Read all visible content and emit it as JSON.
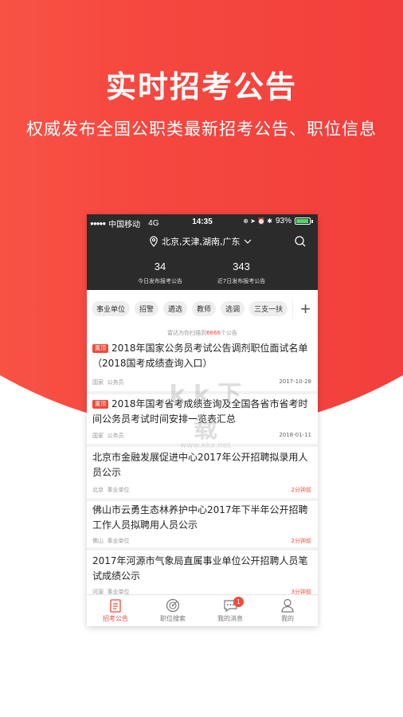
{
  "hero": {
    "title": "实时招考公告",
    "subtitle": "权威发布全国公职类最新招考公告、职位信息"
  },
  "status_bar": {
    "carrier": "中国移动",
    "network": "4G",
    "time": "14:35",
    "battery": "93%"
  },
  "header": {
    "location": "北京,天津,湖南,广东",
    "today_count": "34",
    "today_label": "今日发布报考公告",
    "week_count": "343",
    "week_label": "近7日发布报考公告"
  },
  "tags": [
    "事业单位",
    "招警",
    "遴选",
    "教师",
    "选调",
    "三支一扶"
  ],
  "scan_note": {
    "prefix": "雷达为你扫描到",
    "count": "6666",
    "suffix": "个公告"
  },
  "items": [
    {
      "pin": "置顶",
      "title": "2018年国家公务员考试公告调剂职位面试名单（2018国考成绩查询入口）",
      "region": "国家",
      "type": "公务员",
      "date": "2017-10-28"
    },
    {
      "pin": "置顶",
      "title": "2018年国考省考成绩查询及全国各省市省考时间公务员考试时间安排一览表汇总",
      "region": "国家",
      "type": "公务员",
      "date": "2018-01-11"
    },
    {
      "title": "北京市金融发展促进中心2017年公开招聘拟录用人员公示",
      "region": "北京",
      "type": "事业单位",
      "date": "2分钟前"
    },
    {
      "title": "佛山市云勇生态林养护中心2017年下半年公开招聘工作人员拟聘用人员公示",
      "region": "佛山",
      "type": "事业单位",
      "date": "2分钟前"
    },
    {
      "title": "2017年河源市气象局直属事业单位公开招聘人员笔试成绩公示",
      "region": "河源",
      "type": "事业单位",
      "date": "3分钟前"
    }
  ],
  "tabs": [
    {
      "label": "招考公告",
      "icon": "list-icon",
      "active": true
    },
    {
      "label": "职位搜索",
      "icon": "radar-icon"
    },
    {
      "label": "我的消息",
      "icon": "chat-icon",
      "badge": "1"
    },
    {
      "label": "我的",
      "icon": "user-icon"
    }
  ],
  "watermark": {
    "text": "k k 下载",
    "url": "www.kkx.net"
  },
  "colors": {
    "accent": "#f04a3a",
    "header_bg": "#2b2b2b",
    "hero_red": "#f5473f"
  }
}
